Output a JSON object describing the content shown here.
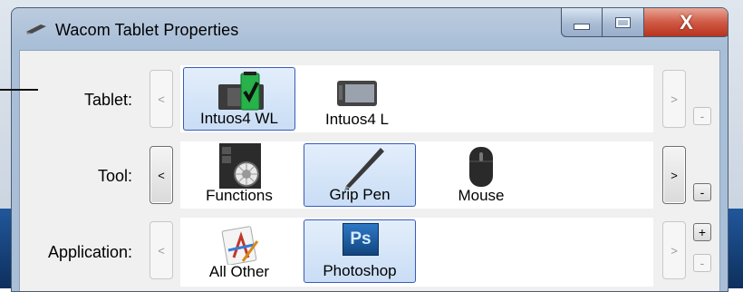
{
  "window": {
    "title": "Wacom Tablet Properties",
    "close_glyph": "X",
    "controls": [
      "minimize-icon",
      "maximize-icon",
      "close-icon"
    ]
  },
  "rows": {
    "tablet": {
      "label": "Tablet:",
      "prev": "<",
      "next": ">",
      "remove": "-",
      "items": [
        {
          "label": "Intuos4 WL",
          "icon": "wireless-tablet-icon",
          "selected": true
        },
        {
          "label": "Intuos4 L",
          "icon": "tablet-icon",
          "selected": false
        }
      ]
    },
    "tool": {
      "label": "Tool:",
      "prev": "<",
      "next": ">",
      "remove": "-",
      "items": [
        {
          "label": "Functions",
          "icon": "functions-icon",
          "selected": false
        },
        {
          "label": "Grip Pen",
          "icon": "pen-icon",
          "selected": true
        },
        {
          "label": "Mouse",
          "icon": "mouse-icon",
          "selected": false
        }
      ]
    },
    "application": {
      "label": "Application:",
      "prev": "<",
      "next": ">",
      "add": "+",
      "remove": "-",
      "items": [
        {
          "label": "All Other",
          "icon": "all-other-icon",
          "selected": false
        },
        {
          "label": "Photoshop",
          "icon": "photoshop-icon",
          "icon_text": "Ps",
          "selected": true
        }
      ]
    }
  },
  "colors": {
    "selection_border": "#3a5bb8",
    "close_button": "#cf5a45",
    "photoshop_blue": "#1e5ea8"
  }
}
